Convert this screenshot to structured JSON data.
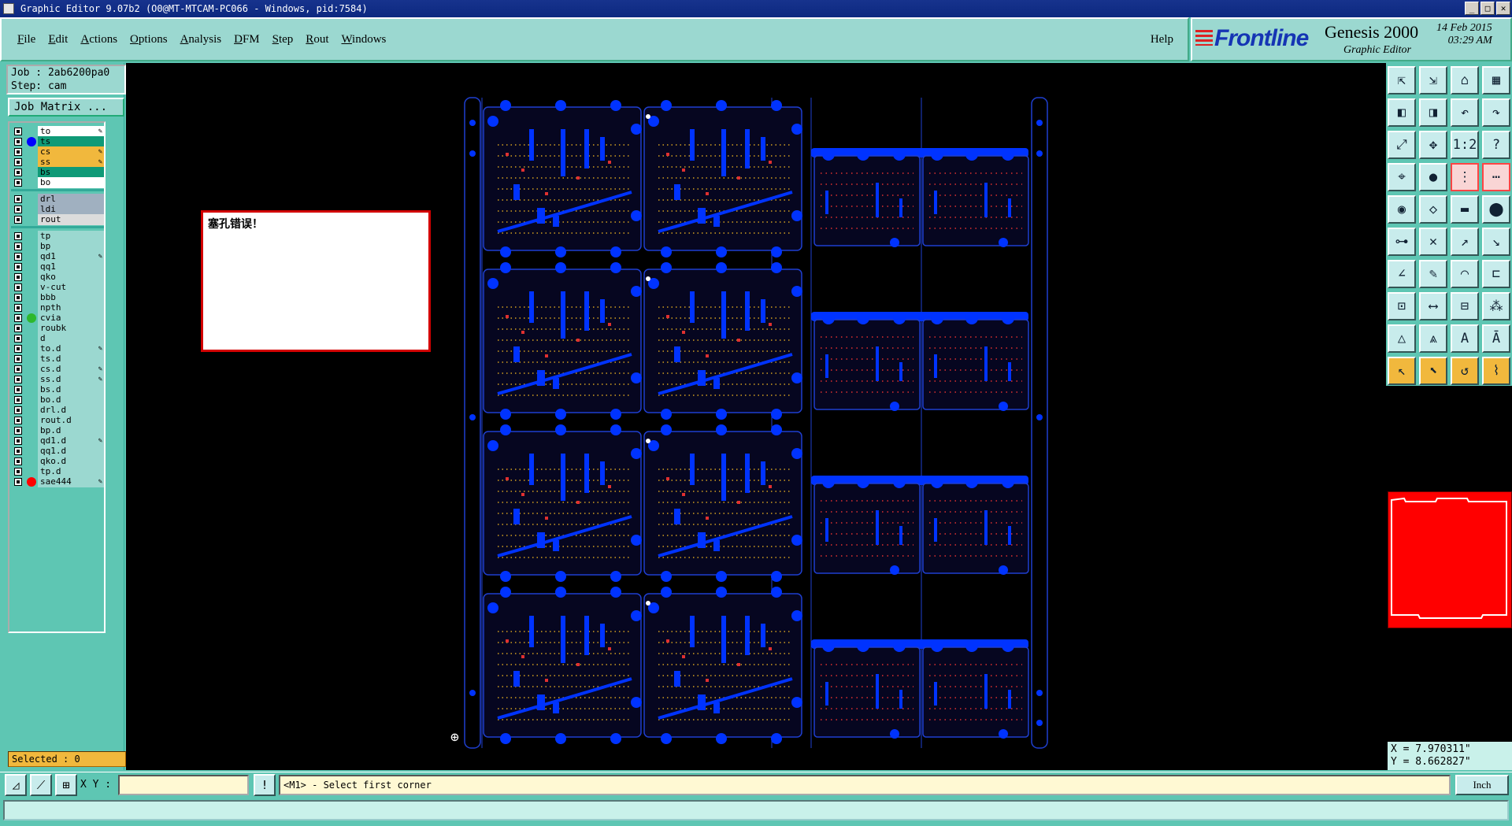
{
  "window": {
    "title": "Graphic Editor 9.07b2 (O0@MT-MTCAM-PC066 - Windows, pid:7584)",
    "buttons": [
      "_",
      "□",
      "✕"
    ]
  },
  "menu": {
    "items": [
      "File",
      "Edit",
      "Actions",
      "Options",
      "Analysis",
      "DFM",
      "Step",
      "Rout",
      "Windows"
    ],
    "help": "Help"
  },
  "brand": {
    "logo": "Frontline",
    "product": "Genesis 2000",
    "subtitle": "Graphic Editor",
    "date": "14 Feb 2015",
    "time": "03:29 AM"
  },
  "job": {
    "job_line": "Job : 2ab6200pa0",
    "step_line": "Step: cam",
    "matrix_button": "Job Matrix ..."
  },
  "layers": {
    "group1": [
      {
        "name": "to",
        "bg": "#ffffff",
        "dot": "",
        "glyph": true
      },
      {
        "name": "ts",
        "bg": "#0f9a77",
        "dot": "#0000ff",
        "glyph": false
      },
      {
        "name": "cs",
        "bg": "#f1b83d",
        "dot": "",
        "glyph": true
      },
      {
        "name": "ss",
        "bg": "#f1b83d",
        "dot": "",
        "glyph": true
      },
      {
        "name": "bs",
        "bg": "#0f9a77",
        "dot": "",
        "glyph": false
      },
      {
        "name": "bo",
        "bg": "#ffffff",
        "dot": "",
        "glyph": false
      }
    ],
    "group2": [
      {
        "name": "drl",
        "bg": "#a0b0c0",
        "dot": "",
        "glyph": false
      },
      {
        "name": "ldi",
        "bg": "#a0b0c0",
        "dot": "",
        "glyph": false
      },
      {
        "name": "rout",
        "bg": "#dcdcdc",
        "dot": "",
        "glyph": false
      }
    ],
    "group3": [
      {
        "name": "tp",
        "bg": "#9bd8d0",
        "dot": "",
        "glyph": false
      },
      {
        "name": "bp",
        "bg": "#9bd8d0",
        "dot": "",
        "glyph": false
      },
      {
        "name": "qd1",
        "bg": "#9bd8d0",
        "dot": "",
        "glyph": true
      },
      {
        "name": "qq1",
        "bg": "#9bd8d0",
        "dot": "",
        "glyph": false
      },
      {
        "name": "qko",
        "bg": "#9bd8d0",
        "dot": "",
        "glyph": false
      },
      {
        "name": "v-cut",
        "bg": "#9bd8d0",
        "dot": "",
        "glyph": false
      },
      {
        "name": "bbb",
        "bg": "#9bd8d0",
        "dot": "",
        "glyph": false
      },
      {
        "name": "npth",
        "bg": "#9bd8d0",
        "dot": "",
        "glyph": false
      },
      {
        "name": "cvia",
        "bg": "#9bd8d0",
        "dot": "#2db82d",
        "glyph": false
      },
      {
        "name": "roubk",
        "bg": "#9bd8d0",
        "dot": "",
        "glyph": false
      },
      {
        "name": "d",
        "bg": "#9bd8d0",
        "dot": "",
        "glyph": false
      },
      {
        "name": "to.d",
        "bg": "#9bd8d0",
        "dot": "",
        "glyph": true
      },
      {
        "name": "ts.d",
        "bg": "#9bd8d0",
        "dot": "",
        "glyph": false
      },
      {
        "name": "cs.d",
        "bg": "#9bd8d0",
        "dot": "",
        "glyph": true
      },
      {
        "name": "ss.d",
        "bg": "#9bd8d0",
        "dot": "",
        "glyph": true
      },
      {
        "name": "bs.d",
        "bg": "#9bd8d0",
        "dot": "",
        "glyph": false
      },
      {
        "name": "bo.d",
        "bg": "#9bd8d0",
        "dot": "",
        "glyph": false
      },
      {
        "name": "drl.d",
        "bg": "#9bd8d0",
        "dot": "",
        "glyph": false
      },
      {
        "name": "rout.d",
        "bg": "#9bd8d0",
        "dot": "",
        "glyph": false
      },
      {
        "name": "bp.d",
        "bg": "#9bd8d0",
        "dot": "",
        "glyph": false
      },
      {
        "name": "qd1.d",
        "bg": "#9bd8d0",
        "dot": "",
        "glyph": true
      },
      {
        "name": "qq1.d",
        "bg": "#9bd8d0",
        "dot": "",
        "glyph": false
      },
      {
        "name": "qko.d",
        "bg": "#9bd8d0",
        "dot": "",
        "glyph": false
      },
      {
        "name": "tp.d",
        "bg": "#9bd8d0",
        "dot": "",
        "glyph": false
      },
      {
        "name": "sae444",
        "bg": "#9bd8d0",
        "dot": "#ff0000",
        "glyph": true
      }
    ]
  },
  "selected": "Selected : 0",
  "message_box": "塞孔错误！",
  "coords": {
    "x": "X = 7.970311\"",
    "y": "Y = 8.662827\""
  },
  "status": {
    "xy_label": "X Y :",
    "xy_value": "",
    "prompt": "<M1> - Select first corner",
    "units": "Inch"
  },
  "colors": {
    "panel": "#5ec6b3",
    "canvas": "#000000",
    "copper": "#0033ff",
    "outline": "#1f3fd0",
    "silk": "#d4a020",
    "mask": "#e03030",
    "alert": "#d20000"
  }
}
